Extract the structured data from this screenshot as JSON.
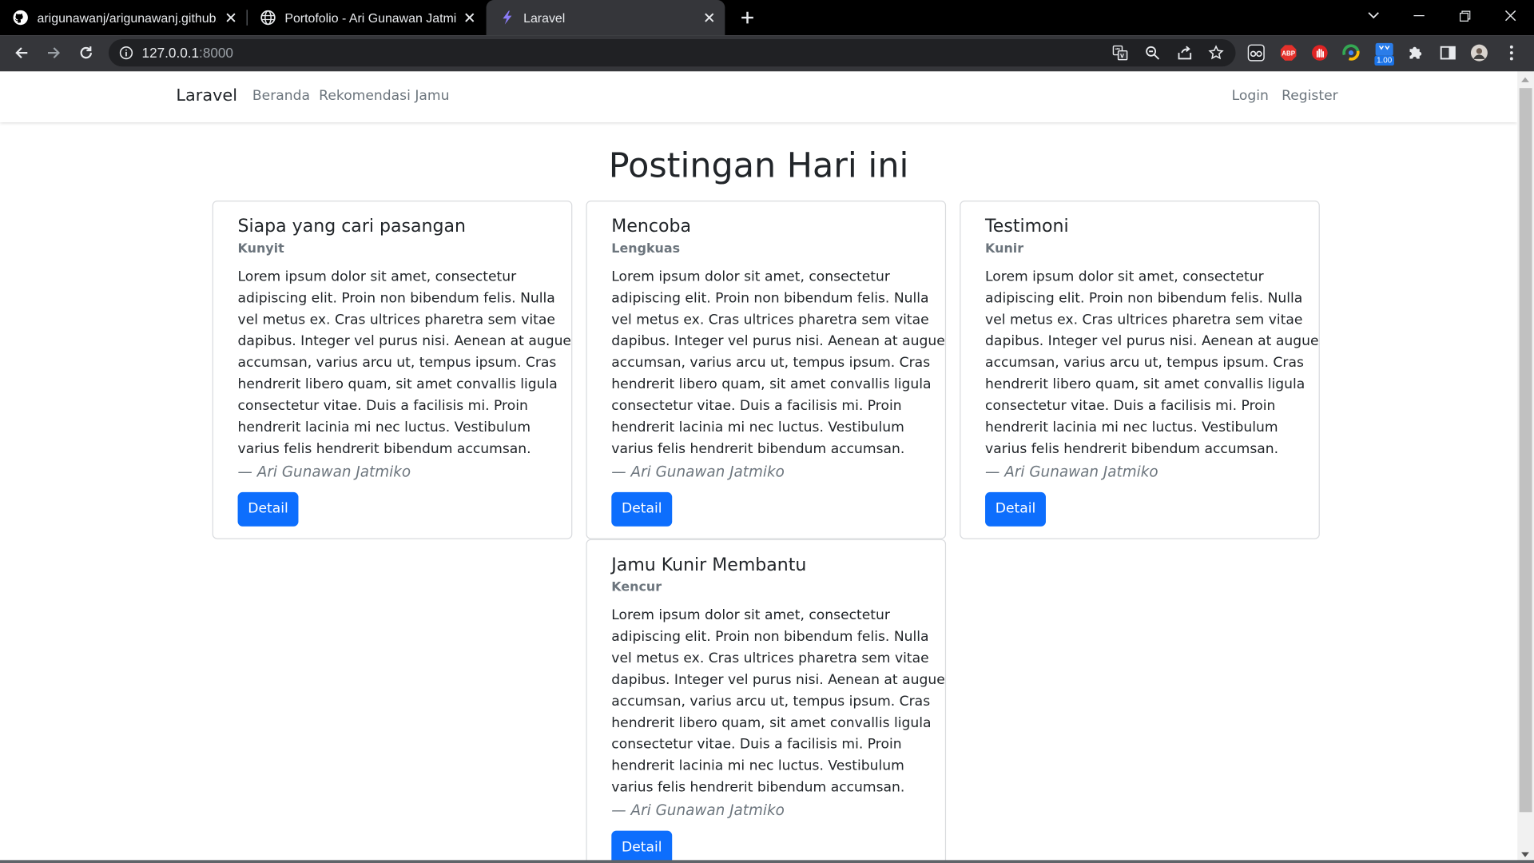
{
  "browser": {
    "tabs": [
      {
        "title": "arigunawanj/arigunawanj.github.",
        "favicon": "github-icon"
      },
      {
        "title": "Portofolio - Ari Gunawan Jatmiko",
        "favicon": "globe-icon"
      },
      {
        "title": "Laravel",
        "favicon": "laravel-icon",
        "active": true
      }
    ],
    "url_host": "127.0.0.1",
    "url_port": ":8000",
    "extension_badge": "1.00"
  },
  "navbar": {
    "brand": "Laravel",
    "links": [
      "Beranda",
      "Rekomendasi Jamu"
    ],
    "auth_links": [
      "Login",
      "Register"
    ]
  },
  "heading": "Postingan Hari ini",
  "body_lines": [
    "Lorem ipsum dolor sit amet, consectetur",
    "adipiscing elit. Proin non bibendum felis. Nulla",
    "vel metus ex. Cras ultrices pharetra sem vitae",
    "dapibus. Integer vel purus nisi. Aenean at augue",
    "accumsan, varius arcu ut, tempus ipsum. Cras",
    "hendrerit libero quam, sit amet convallis ligula",
    "consectetur vitae. Duis a facilisis mi. Proin",
    "hendrerit lacinia mi nec luctus. Vestibulum",
    "varius felis hendrerit bibendum accumsan."
  ],
  "posts": [
    {
      "title": "Siapa yang cari pasangan",
      "subtitle": "Kunyit",
      "author": "— Ari Gunawan Jatmiko",
      "button": "Detail"
    },
    {
      "title": "Mencoba",
      "subtitle": "Lengkuas",
      "author": "— Ari Gunawan Jatmiko",
      "button": "Detail"
    },
    {
      "title": "Testimoni",
      "subtitle": "Kunir",
      "author": "— Ari Gunawan Jatmiko",
      "button": "Detail"
    },
    {
      "title": "Jamu Kunir Membantu",
      "subtitle": "Kencur",
      "author": "— Ari Gunawan Jatmiko",
      "button": "Detail"
    }
  ],
  "colors": {
    "primary_button": "#0d6efd",
    "muted_text": "#6c757d",
    "browser_frame": "#35363a"
  }
}
